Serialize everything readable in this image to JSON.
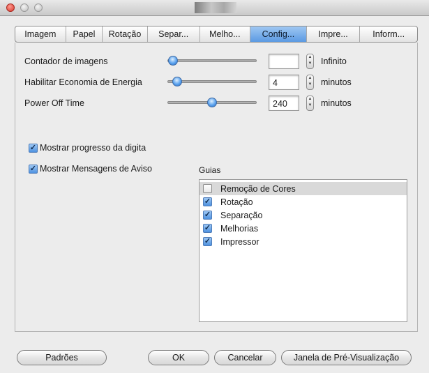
{
  "window": {
    "controls": [
      "close",
      "minimize",
      "zoom"
    ]
  },
  "tabs": [
    {
      "label": "Imagem",
      "active": false
    },
    {
      "label": "Papel",
      "active": false
    },
    {
      "label": "Rotação",
      "active": false
    },
    {
      "label": "Separ...",
      "active": false
    },
    {
      "label": "Melho...",
      "active": false
    },
    {
      "label": "Config...",
      "active": true
    },
    {
      "label": "Impre...",
      "active": false
    },
    {
      "label": "Inform...",
      "active": false
    }
  ],
  "settings": {
    "image_counter": {
      "label": "Contador de imagens",
      "value": "",
      "unit": "Infinito",
      "slider_level": 0.0
    },
    "energy_saving": {
      "label": "Habilitar Economia de Energia",
      "value": "4",
      "unit": "minutos",
      "slider_level": 0.05
    },
    "power_off": {
      "label": "Power Off Time",
      "value": "240",
      "unit": "minutos",
      "slider_level": 0.5
    }
  },
  "options": {
    "show_progress": {
      "label": "Mostrar progresso da digita",
      "checked": true
    },
    "show_warnings": {
      "label": "Mostrar Mensagens de Aviso",
      "checked": true
    }
  },
  "guias": {
    "label": "Guias",
    "items": [
      {
        "label": "Remoção de Cores",
        "checked": false,
        "selected": true
      },
      {
        "label": "Rotação",
        "checked": true,
        "selected": false
      },
      {
        "label": "Separação",
        "checked": true,
        "selected": false
      },
      {
        "label": "Melhorias",
        "checked": true,
        "selected": false
      },
      {
        "label": "Impressor",
        "checked": true,
        "selected": false
      }
    ]
  },
  "buttons": {
    "defaults": "Padrões",
    "ok": "OK",
    "cancel": "Cancelar",
    "preview": "Janela de Pré-Visualização"
  },
  "colors": {
    "active_tab": "#5b9ae3",
    "slider_knob": "#5aa2ee",
    "checkbox": "#4e92e0",
    "close_button": "#d8382d"
  }
}
